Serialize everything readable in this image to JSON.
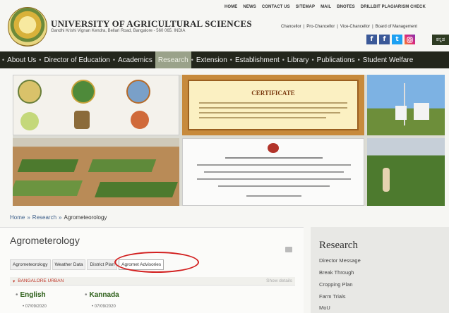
{
  "toplinks": [
    "HOME",
    "NEWS",
    "CONTACT US",
    "SITEMAP",
    "MAIL",
    "BNOTES",
    "DRILLBIT PLAGIARISM CHECK"
  ],
  "header": {
    "university_name": "UNIVERSITY OF AGRICULTURAL SCIENCES",
    "address": "Gandhi Krishi Vignan Kendra, Bellari Road, Bangalore - 560 065. INDIA",
    "officials": [
      "Chancellor",
      "Pro-Chancellor",
      "Vice-Chancellor",
      "Board of Management"
    ],
    "kannada_label": "ಕನ್ನಡ"
  },
  "social": {
    "facebook": "f",
    "twitter": "t"
  },
  "nav": {
    "items": [
      "About Us",
      "Director of Education",
      "Academics",
      "Research",
      "Extension",
      "Establishment",
      "Library",
      "Publications",
      "Student Welfare"
    ],
    "active_index": 3
  },
  "banner": {
    "cert_heading": "CERTIFICATE"
  },
  "breadcrumb": {
    "home": "Home",
    "research": "Research",
    "current": "Agrometeorology"
  },
  "main": {
    "title": "Agrometerology",
    "tabs": [
      "Agrometeorology",
      "Weather Data",
      "District Plan",
      "Agromet Advisories"
    ],
    "active_tab_index": 3,
    "region": "BANGALORE URBAN",
    "region_right": "Show details",
    "languages": [
      {
        "name": "English",
        "date": "07/09/2020"
      },
      {
        "name": "Kannada",
        "date": "07/09/2020"
      }
    ]
  },
  "sidebar": {
    "title": "Research",
    "items": [
      "Director Message",
      "Break Through",
      "Cropping Plan",
      "Farm Trials",
      "MoU"
    ]
  },
  "colors": {
    "nav_bg": "#23261c",
    "active_nav": "#9aa28a",
    "link": "#3d5f8a",
    "highlight": "#d21f1f"
  }
}
